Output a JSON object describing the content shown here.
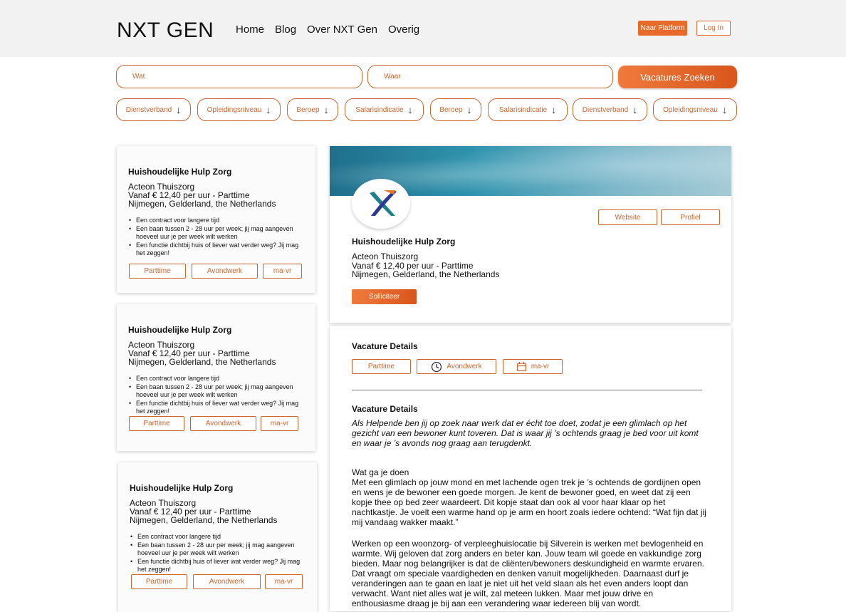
{
  "header": {
    "logo": "NXT GEN",
    "nav": [
      "Home",
      "Blog",
      "Over NXT Gen",
      "Overig"
    ],
    "platform_button": "Naar Platform",
    "login_button": "Log In"
  },
  "search": {
    "wat_placeholder": "Wat",
    "waar_placeholder": "Waar",
    "button": "Vacatures Zoeken"
  },
  "filters": [
    "Dienstverband",
    "Opleidingsniveau",
    "Beroep",
    "Salarisindicatie",
    "Beroep",
    "Salarisindicatie",
    "Dienstverband",
    "Opleidingsniveau"
  ],
  "cards": [
    {
      "title": "Huishoudelijke Hulp Zorg",
      "company": "Acteon Thuiszorg",
      "salary": "Vanaf € 12,40 per uur - Parttime",
      "location": "Nijmegen, Gelderland, the Netherlands",
      "bullets": [
        "Een contract voor langere tijd",
        "Een baan tussen 2 - 28 uur per week; jij mag aangeven hoeveel uur je per week wilt werken",
        "Een functie dichtbij huis of liever wat verder weg? Jij mag het zeggen!"
      ],
      "tags": [
        "Parttime",
        "Avondwerk",
        "ma-vr"
      ]
    },
    {
      "title": "Huishoudelijke Hulp Zorg",
      "company": "Acteon Thuiszorg",
      "salary": "Vanaf € 12,40 per uur - Parttime",
      "location": "Nijmegen, Gelderland, the Netherlands",
      "bullets": [
        "Een contract voor langere tijd",
        "Een baan tussen 2 - 28 uur per week; jij mag aangeven hoeveel uur je per week wilt werken",
        "Een functie dichtbij huis of liever wat verder weg? Jij mag het zeggen!"
      ],
      "tags": [
        "Parttime",
        "Avondwerk",
        "ma-vr"
      ]
    },
    {
      "title": "Huishoudelijke Hulp Zorg",
      "company": "Acteon Thuiszorg",
      "salary": "Vanaf € 12,40 per uur - Parttime",
      "location": "Nijmegen, Gelderland, the Netherlands",
      "bullets": [
        "Een contract voor langere tijd",
        "Een baan tussen 2 - 28 uur per week; jij mag aangeven hoeveel uur je per week wilt werken",
        "Een functie dichtbij huis of liever wat verder weg? Jij mag het zeggen!"
      ],
      "tags": [
        "Parttime",
        "Avondwerk",
        "ma-vr"
      ]
    }
  ],
  "detail": {
    "website_button": "Website",
    "profile_button": "Profiel",
    "title": "Huishoudelijke Hulp Zorg",
    "company": "Acteon Thuiszorg",
    "salary": "Vanaf € 12,40 per uur - Parttime",
    "location": "Nijmegen, Gelderland, the Netherlands",
    "apply_button": "Solliciteer",
    "details_heading": "Vacature Details",
    "chips": [
      "Parttime",
      "Avondwerk",
      "ma-vr"
    ],
    "description_heading": "Vacature Details",
    "intro": "Als Helpende ben jij op zoek naar werk dat er écht toe doet, zodat je een glimlach op het gezicht van een bewoner kunt toveren. Dat is waar jij ’s ochtends graag je bed voor uit komt en waar je ’s avonds nog graag aan terugdenkt.",
    "what_heading": "Wat ga je doen",
    "what_text": "Met een glimlach op jouw mond en met lachende ogen trek je ’s ochtends de gordijnen open en wens je de bewoner een goede morgen. Je kent de bewoner goed, en weet dat zij een kopje thee op bed zeer waardeert. Dit kopje staat dan ook al voor haar klaar op het nachtkastje. Je voelt een warme hand op je arm en hoort zoals iedere ochtend: “Wat fijn dat jij mij vandaag wakker maakt.”",
    "work_text": "Werken op een woonzorg- of verpleeghuislocatie bij Silverein is werken met bevlogenheid en warmte. Wij geloven dat zorg anders en beter kan. Jouw team wil goede en vakkundige zorg bieden. Maar nog belangrijker is dat de cliënten/bewoners deskundigheid en warmte ervaren. Dat vraagt om speciale vaardigheden en denken vanuit mogelijkheden. Daarnaast durf je veranderingen aan te gaan en laat je niet uit het veld slaan als het even anders loopt dan verwacht. Want niet alles wat je wilt, zal meteen lukken. Maar met jouw drive en enthousiasme draag je bij aan een verandering waar iedereen blij van wordt."
  },
  "colors": {
    "accent": "#e86a2a",
    "border": "#c9662f"
  }
}
